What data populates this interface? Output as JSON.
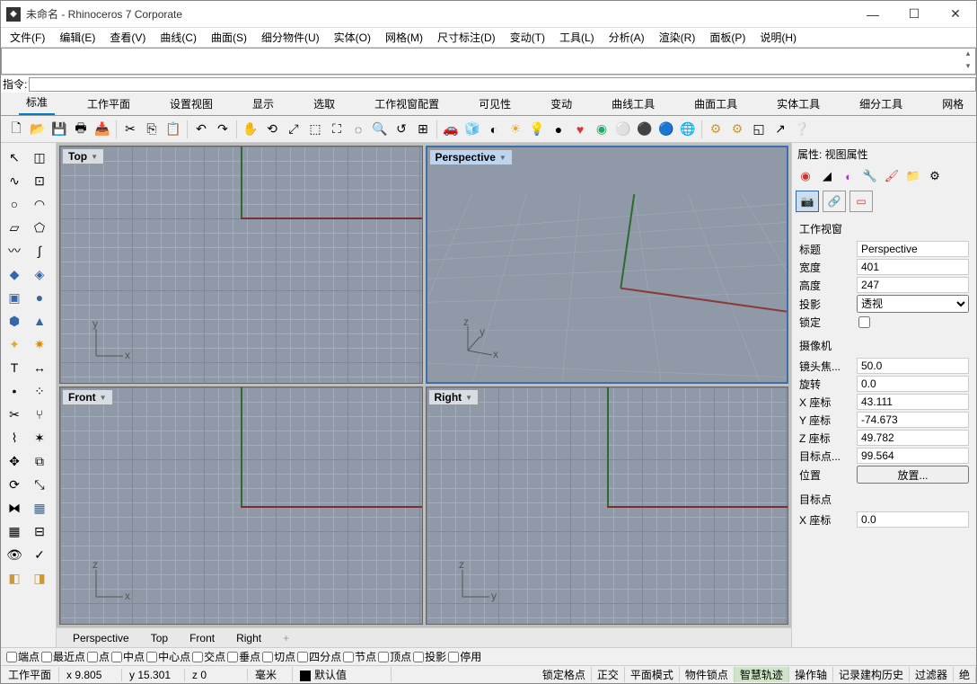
{
  "title": "未命名 - Rhinoceros 7 Corporate",
  "menu": [
    "文件(F)",
    "编辑(E)",
    "查看(V)",
    "曲线(C)",
    "曲面(S)",
    "细分物件(U)",
    "实体(O)",
    "网格(M)",
    "尺寸标注(D)",
    "变动(T)",
    "工具(L)",
    "分析(A)",
    "渲染(R)",
    "面板(P)",
    "说明(H)"
  ],
  "cmd_label": "指令:",
  "cmd_value": "",
  "ribbon_tabs": [
    "标准",
    "工作平面",
    "设置视图",
    "显示",
    "选取",
    "工作视窗配置",
    "可见性",
    "变动",
    "曲线工具",
    "曲面工具",
    "实体工具",
    "细分工具",
    "网格"
  ],
  "viewports": {
    "top": {
      "label": "Top",
      "axes": [
        "x",
        "y"
      ]
    },
    "persp": {
      "label": "Perspective",
      "axes": [
        "x",
        "y",
        "z"
      ]
    },
    "front": {
      "label": "Front",
      "axes": [
        "x",
        "z"
      ]
    },
    "right": {
      "label": "Right",
      "axes": [
        "y",
        "z"
      ]
    }
  },
  "vp_tabs": [
    "Perspective",
    "Top",
    "Front",
    "Right",
    "+"
  ],
  "right": {
    "header": "属性: 视图属性",
    "sections": {
      "viewport": {
        "title": "工作视窗",
        "title_lbl": "标题",
        "title_val": "Perspective",
        "width_lbl": "宽度",
        "width_val": "401",
        "height_lbl": "高度",
        "height_val": "247",
        "proj_lbl": "投影",
        "proj_val": "透视",
        "lock_lbl": "锁定"
      },
      "camera": {
        "title": "摄像机",
        "lens_lbl": "镜头焦...",
        "lens_val": "50.0",
        "rot_lbl": "旋转",
        "rot_val": "0.0",
        "x_lbl": "X 座标",
        "x_val": "43.111",
        "y_lbl": "Y 座标",
        "y_val": "-74.673",
        "z_lbl": "Z 座标",
        "z_val": "49.782",
        "tgt_lbl": "目标点...",
        "tgt_val": "99.564",
        "pos_lbl": "位置",
        "pos_btn": "放置..."
      },
      "target": {
        "title": "目标点",
        "tx_lbl": "X 座标",
        "tx_val": "0.0"
      }
    }
  },
  "osnap": [
    "端点",
    "最近点",
    "点",
    "中点",
    "中心点",
    "交点",
    "垂点",
    "切点",
    "四分点",
    "节点",
    "顶点",
    "投影",
    "停用"
  ],
  "status": {
    "cplane": "工作平面",
    "x": "x 9.805",
    "y": "y 15.301",
    "z": "z 0",
    "unit": "毫米",
    "layer": "默认值",
    "panes": [
      "锁定格点",
      "正交",
      "平面模式",
      "物件锁点",
      "智慧轨迹",
      "操作轴",
      "记录建构历史",
      "过滤器"
    ],
    "extra": "绝"
  }
}
